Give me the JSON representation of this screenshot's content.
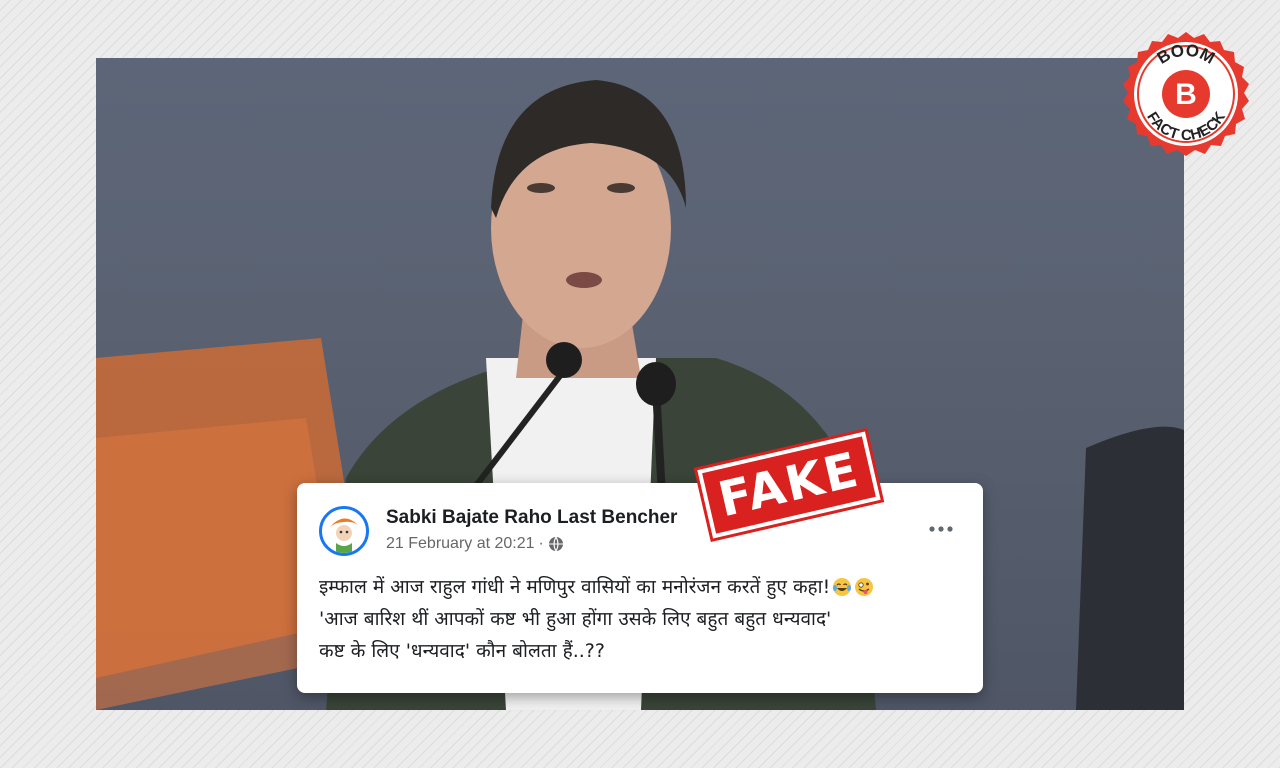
{
  "post": {
    "author": "Sabki Bajate Raho Last Bencher",
    "timestamp": "21 February at 20:21",
    "separator": "·",
    "privacy_icon": "globe-icon",
    "more_icon": "more-options-icon",
    "lines": [
      "इम्फाल में आज राहुल गांधी ने मणिपुर वासियों का मनोरंजन करतें हुए कहा!",
      "'आज बारिश थीं आपकों कष्ट भी हुआ होंगा उसके लिए बहुत बहुत धन्यवाद'",
      "कष्ट के लिए 'धन्यवाद' कौन बोलता हैं..??"
    ],
    "emojis": [
      "face-with-tears-of-joy-icon",
      "zany-face-icon"
    ]
  },
  "stamp": {
    "label": "FAKE",
    "color": "#d9211f"
  },
  "badge": {
    "brand_top": "BOOM",
    "letter": "B",
    "brand_bottom": "FACT CHECK",
    "color": "#e63a2e"
  }
}
